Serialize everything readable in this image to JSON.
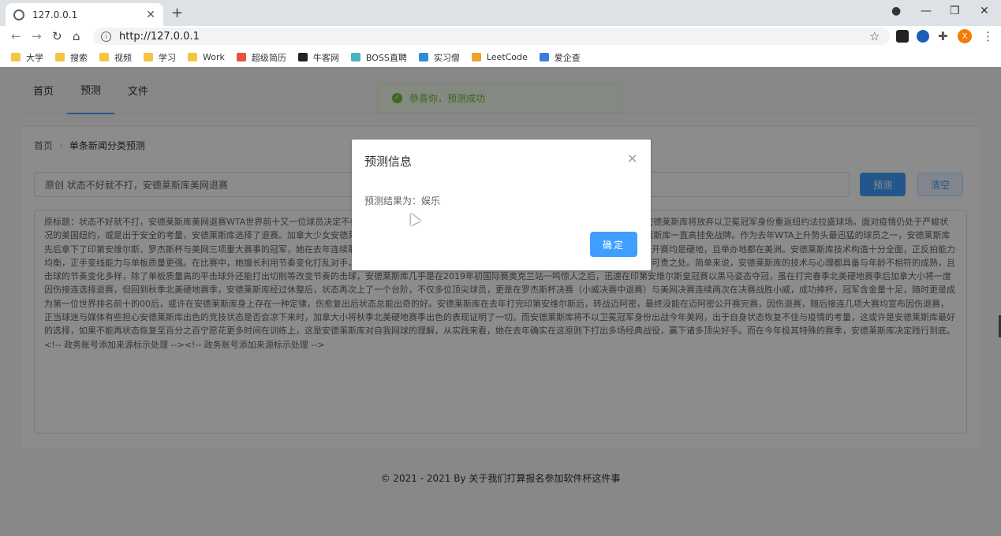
{
  "browser": {
    "tab_title": "127.0.0.1",
    "url": "http://127.0.0.1",
    "new_tab": "+",
    "avatar_letter": "X",
    "window_controls": {
      "minimize": "—",
      "maximize": "❐",
      "close": "✕"
    }
  },
  "bookmarks": [
    {
      "label": "大学",
      "icon": "folder-icon",
      "color": "#f5c542"
    },
    {
      "label": "搜索",
      "icon": "folder-icon",
      "color": "#f5c542"
    },
    {
      "label": "视频",
      "icon": "folder-icon",
      "color": "#f5c542"
    },
    {
      "label": "学习",
      "icon": "folder-icon",
      "color": "#f5c542"
    },
    {
      "label": "Work",
      "icon": "folder-icon",
      "color": "#f5c542"
    },
    {
      "label": "超级简历",
      "icon": "resume-icon",
      "color": "#e8533f"
    },
    {
      "label": "牛客网",
      "icon": "nowcoder-icon",
      "color": "#222222"
    },
    {
      "label": "BOSS直聘",
      "icon": "boss-icon",
      "color": "#4ab3c2"
    },
    {
      "label": "实习僧",
      "icon": "shixiseng-icon",
      "color": "#2a8fd8"
    },
    {
      "label": "LeetCode",
      "icon": "leetcode-icon",
      "color": "#f0a030"
    },
    {
      "label": "爱企查",
      "icon": "aiqicha-icon",
      "color": "#3b7ddd"
    }
  ],
  "nav": {
    "items": [
      "首页",
      "预测",
      "文件"
    ],
    "active": "预测"
  },
  "toast": {
    "message": "恭喜你，预测成功"
  },
  "breadcrumb": {
    "home": "首页",
    "current": "单条新闻分类预测"
  },
  "form": {
    "title_value": "原创 状态不好就不打，安德莱斯库美网退赛",
    "predict_label": "预测",
    "clear_label": "清空",
    "content": "原标题：状态不好就不打，安德莱斯库美网退赛WTA世界前十又一位球员决定不参加美网，安德莱斯库在自己的社交媒体发表声明，出于对自身状态的考虑，安德莱斯库将放弃以卫冕冠军身份重返纽约法拉盛球场。面对疫情仍处于严峻状况的美国纽约，或是出于安全的考量，安德莱斯库选择了退赛。加拿大少女安德莱斯库在去年夏天取得了突破，然而之后她在WTA年终总决赛因伤退赛，安德莱斯库一直高挂免战牌。作为去年WTA上升势头最迅猛的球员之一，安德莱斯库先后拿下了印第安维尔斯、罗杰斯杯与美网三项重大赛事的冠军，她在去年连续取得的佳绩证明了自身具备在顶级赛事上的出色表现。值得一提的是，这三项公开赛均是硬地，且举办地都在美洲。安德莱斯库技术构造十分全面，正反拍能力均衡，正手变线能力与单板质量更强。在比赛中，她擅长利用节奏变化打乱对手，同时具备很强的战术意识，是安德莱斯库比起其他顶尖女子网球运动员最难得可贵之处。简单来说，安德莱斯库的技术与心理都具备与年龄不相符的成熟，且击球的节奏变化多样，除了单板质量高的平击球外还能打出切削等改变节奏的击球，安德莱斯库几乎是在2019年初国际赛奥克兰站一鸣惊人之后，迅速在印第安维尔斯皇冠赛以黑马姿态夺冠，虽在打完春季北美硬地赛季后加拿大小将一度因伤接连选择退赛，但回到秋季北美硬地赛季，安德莱斯库经过休整后，状态再次上了一个台阶，不仅多位顶尖球员，更是在罗杰斯杯决赛（小威决赛中退赛）与美网决赛连续两次在决赛战胜小威，成功捧杯，冠军含金量十足，随时更是成为第一位世界排名前十的00后，或许在安德莱斯库身上存在一种定律，伤愈复出后状态总能出奇的好。安德莱斯库在去年打完印第安维尔斯后，转战迈阿密，最终没能在迈阿密公开赛完赛，因伤退赛，随后接连几项大赛均宣布因伤退赛，正当球迷与媒体有些担心安德莱斯库出色的竞技状态是否会凉下来时，加拿大小将秋季北美硬地赛季出色的表现证明了一切。而安德莱斯库将不以卫冕冠军身份出战今年美网，出于自身状态恢复不佳与疫情的考量，这或许是安德莱斯库最好的选择，如果不能再状态恢复至百分之百宁愿花更多时间在训练上，这是安德莱斯库对自我网球的理解，从实践来看，她在去年确实在这原则下打出多场经典战役，赢下诸多顶尖好手。而在今年极其特殊的赛季，安德莱斯库决定践行到底。<!-- 政务账号添加来源标示处理 --><!-- 政务账号添加来源标示处理 -->"
  },
  "footer": {
    "text": "© 2021 - 2021 By 关于我们打算报名参加软件杯这件事"
  },
  "dialog": {
    "title": "预测信息",
    "result_text": "预测结果为：娱乐",
    "confirm_label": "确定",
    "close_glyph": "×"
  },
  "colors": {
    "primary": "#409eff",
    "success": "#67c23a"
  }
}
